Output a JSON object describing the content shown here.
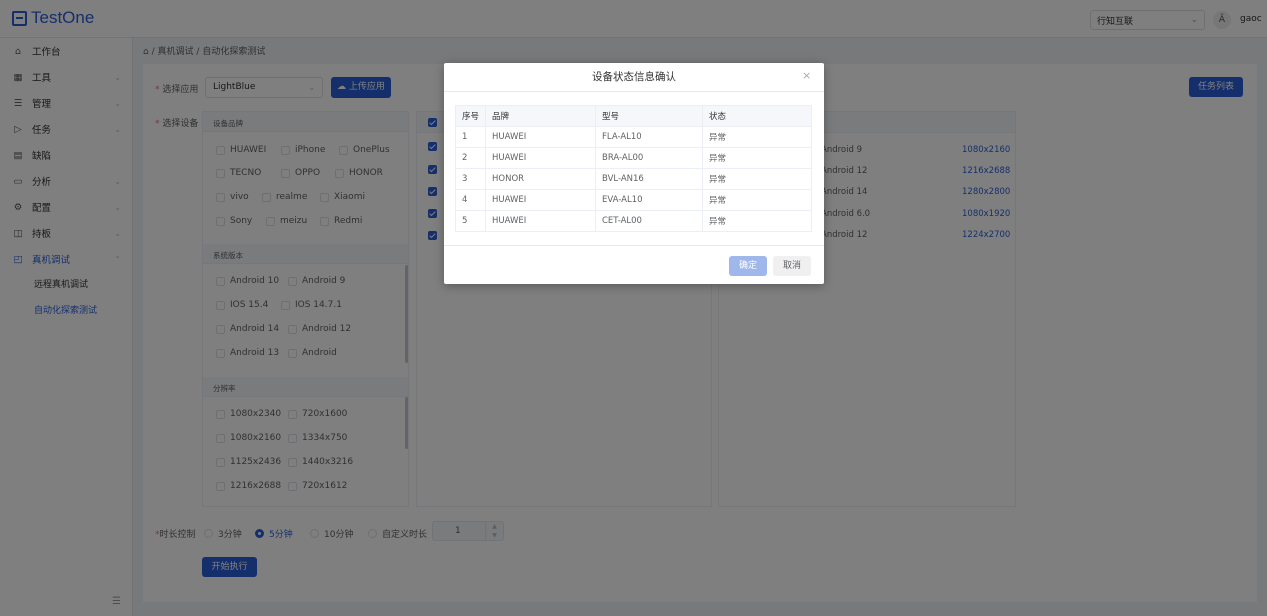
{
  "header": {
    "logo_text": "TestOne",
    "org_select": "行知互联",
    "lang_icon": "Ã",
    "user": "gaoc"
  },
  "sidebar": {
    "items": [
      {
        "label": "工作台",
        "icon": "home-icon"
      },
      {
        "label": "工具",
        "icon": "grid-icon"
      },
      {
        "label": "管理",
        "icon": "list-icon"
      },
      {
        "label": "任务",
        "icon": "play-icon"
      },
      {
        "label": "缺陷",
        "icon": "doc-icon"
      },
      {
        "label": "分析",
        "icon": "calendar-icon"
      },
      {
        "label": "配置",
        "icon": "gear-icon"
      },
      {
        "label": "持板",
        "icon": "board-icon"
      },
      {
        "label": "真机调试",
        "icon": "device-icon"
      }
    ],
    "sub_items": [
      {
        "label": "远程真机调试"
      },
      {
        "label": "自动化探索测试"
      }
    ]
  },
  "breadcrumb": {
    "home_icon": "⌂",
    "level1": "真机调试",
    "sep": "/",
    "level2": "自动化探索测试"
  },
  "form": {
    "app_label": "选择应用",
    "app_value": "LightBlue",
    "upload_label": "上传应用",
    "tasks_label": "任务列表",
    "device_label": "选择设备",
    "duration_label": "时长控制",
    "start_label": "开始执行",
    "stepper_value": "1"
  },
  "filters": {
    "brand_head": "设备品牌",
    "brands": [
      "HUAWEI",
      "iPhone",
      "OnePlus",
      "TECNO",
      "OPPO",
      "HONOR",
      "vivo",
      "realme",
      "Xiaomi",
      "Sony",
      "meizu",
      "Redmi"
    ],
    "os_head": "系统版本",
    "os": [
      "Android 10",
      "Android 9",
      "IOS 15.4",
      "IOS 14.7.1",
      "Android 14",
      "Android 12",
      "Android 13",
      "Android"
    ],
    "res_head": "分辨率",
    "res": [
      "1080x2340",
      "720x1600",
      "1080x2160",
      "1334x750",
      "1125x2436",
      "1440x3216",
      "1216x2688",
      "720x1612"
    ]
  },
  "devices": [
    {
      "version": "Android 9",
      "resolution": "1080x2160"
    },
    {
      "version": "Android 12",
      "resolution": "1216x2688"
    },
    {
      "version": "Android 14",
      "resolution": "1280x2800"
    },
    {
      "version": "Android 6.0",
      "resolution": "1080x1920"
    },
    {
      "version": "Android 12",
      "resolution": "1224x2700"
    }
  ],
  "durations": [
    "3分钟",
    "5分钟",
    "10分钟",
    "自定义时长"
  ],
  "modal": {
    "title": "设备状态信息确认",
    "close": "×",
    "columns": [
      "序号",
      "品牌",
      "型号",
      "状态"
    ],
    "rows": [
      [
        "1",
        "HUAWEI",
        "FLA-AL10",
        "异常"
      ],
      [
        "2",
        "HUAWEI",
        "BRA-AL00",
        "异常"
      ],
      [
        "3",
        "HONOR",
        "BVL-AN16",
        "异常"
      ],
      [
        "4",
        "HUAWEI",
        "EVA-AL10",
        "异常"
      ],
      [
        "5",
        "HUAWEI",
        "CET-AL00",
        "异常"
      ]
    ],
    "ok_label": "确定",
    "cancel_label": "取消"
  },
  "colors": {
    "primary": "#2b5fd9",
    "danger": "#f56c6c"
  }
}
